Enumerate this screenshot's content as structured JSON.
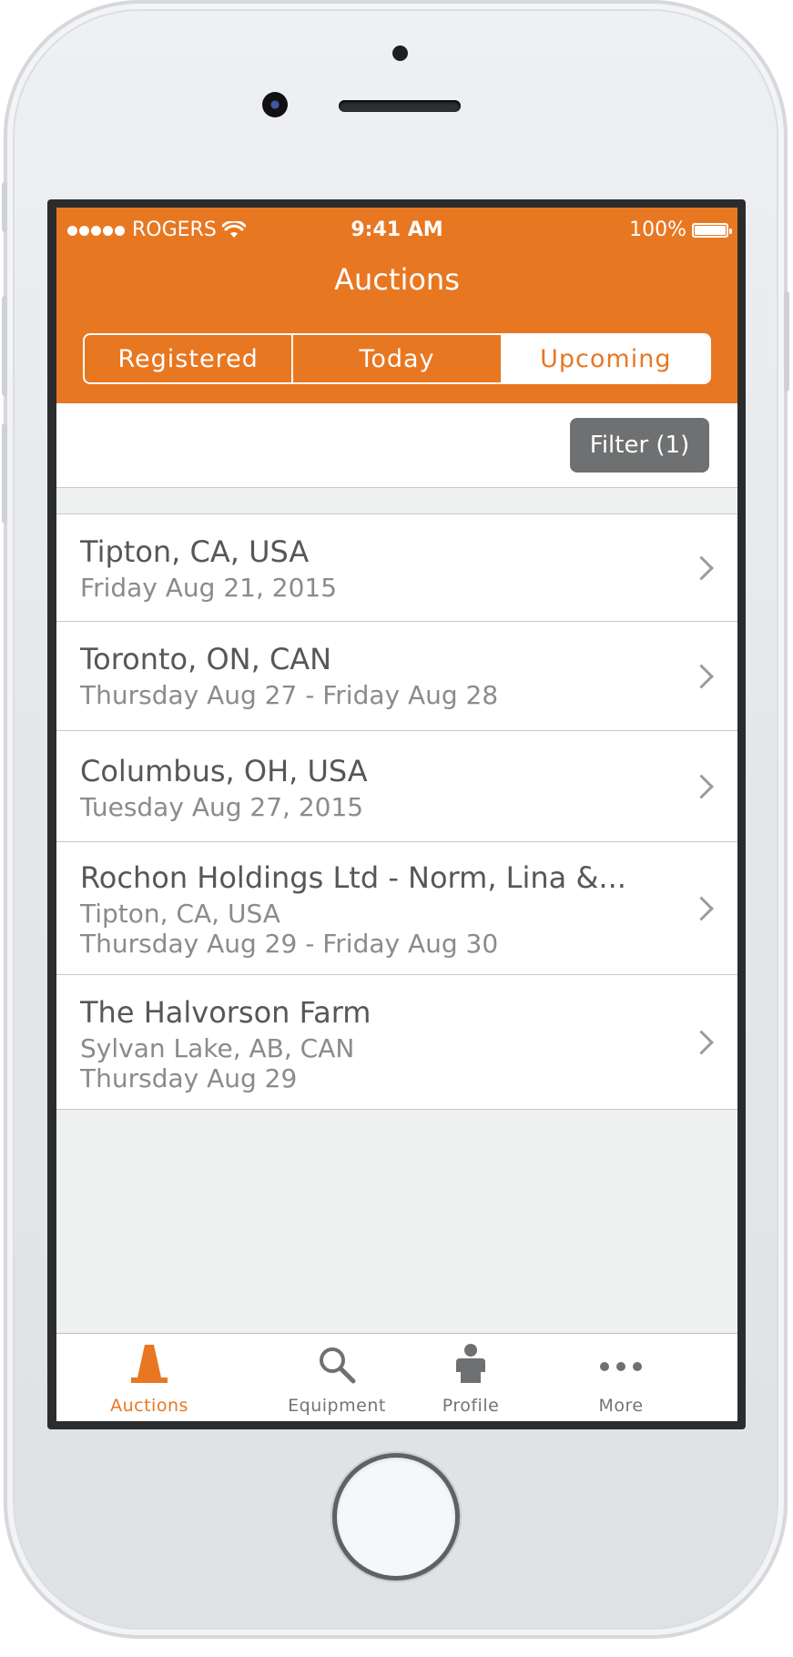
{
  "status_bar": {
    "carrier": "ROGERS",
    "time": "9:41 AM",
    "battery": "100%"
  },
  "nav": {
    "title": "Auctions"
  },
  "segments": [
    "Registered",
    "Today",
    "Upcoming"
  ],
  "selected_segment": "Upcoming",
  "filter": {
    "label": "Filter (1)"
  },
  "auctions": [
    {
      "title": "Tipton, CA, USA",
      "lines": [
        "Friday Aug 21, 2015"
      ]
    },
    {
      "title": "Toronto, ON, CAN",
      "lines": [
        "Thursday Aug 27 - Friday Aug 28"
      ]
    },
    {
      "title": "Columbus, OH, USA",
      "lines": [
        "Tuesday Aug 27, 2015"
      ]
    },
    {
      "title": "Rochon Holdings Ltd - Norm, Lina &...",
      "lines": [
        "Tipton, CA, USA",
        "Thursday Aug 29 - Friday Aug 30"
      ]
    },
    {
      "title": "The Halvorson Farm",
      "lines": [
        "Sylvan Lake, AB, CAN",
        "Thursday Aug 29"
      ]
    }
  ],
  "tabs": [
    {
      "label": "Auctions",
      "icon": "cone-icon",
      "active": true
    },
    {
      "label": "Equipment",
      "icon": "search-icon",
      "active": false
    },
    {
      "label": "Profile",
      "icon": "person-icon",
      "active": false
    },
    {
      "label": "More",
      "icon": "more-icon",
      "active": false
    }
  ],
  "colors": {
    "accent": "#e87722",
    "tab_inactive": "#737475",
    "filter_button": "#6f7071"
  }
}
